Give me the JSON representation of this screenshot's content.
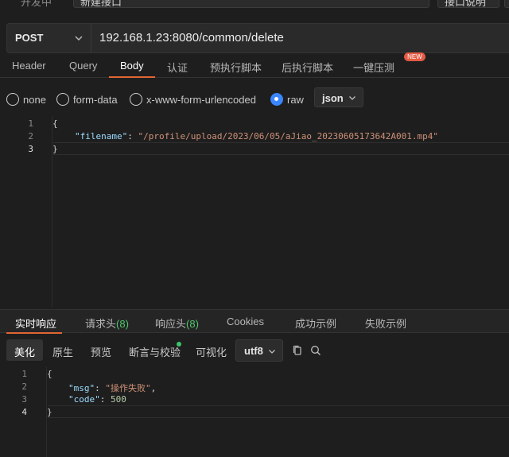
{
  "top": {
    "label": "开发中",
    "name_value": "新建接口",
    "button": "接口说明"
  },
  "request": {
    "method": "POST",
    "url": "192.168.1.23:8080/common/delete"
  },
  "tabs": [
    {
      "label": "Header"
    },
    {
      "label": "Query"
    },
    {
      "label": "Body"
    },
    {
      "label": "认证"
    },
    {
      "label": "预执行脚本"
    },
    {
      "label": "后执行脚本"
    },
    {
      "label": "一键压测"
    }
  ],
  "active_tab": "Body",
  "new_badge": "NEW",
  "body_types": [
    {
      "label": "none",
      "selected": false
    },
    {
      "label": "form-data",
      "selected": false
    },
    {
      "label": "x-www-form-urlencoded",
      "selected": false
    },
    {
      "label": "raw",
      "selected": true
    }
  ],
  "raw_format": "json",
  "request_body": {
    "line_numbers": [
      "1",
      "2",
      "3"
    ],
    "open_brace": "{",
    "key": "\"filename\"",
    "colon": ": ",
    "value": "\"/profile/upload/2023/06/05/aJiao_20230605173642A001.mp4\"",
    "close_brace": "}"
  },
  "response_tabs": [
    {
      "label": "实时响应",
      "count": ""
    },
    {
      "label": "请求头",
      "count": "(8)"
    },
    {
      "label": "响应头",
      "count": "(8)"
    },
    {
      "label": "Cookies",
      "count": ""
    },
    {
      "label": "成功示例",
      "count": ""
    },
    {
      "label": "失败示例",
      "count": ""
    }
  ],
  "view_modes": [
    {
      "label": "美化"
    },
    {
      "label": "原生"
    },
    {
      "label": "预览"
    },
    {
      "label": "断言与校验"
    },
    {
      "label": "可视化"
    }
  ],
  "encoding": "utf8",
  "response_body": {
    "line_numbers": [
      "1",
      "2",
      "3",
      "4"
    ],
    "open_brace": "{",
    "msg_key": "\"msg\"",
    "msg_value": "\"操作失败\"",
    "code_key": "\"code\"",
    "code_value": "500",
    "close_brace": "}"
  },
  "colors": {
    "accent": "#e06633",
    "radio_selected": "#3a86ff",
    "count_green": "#4ec96b",
    "json_key": "#9cdcfe",
    "json_string": "#ce9178",
    "json_number": "#b5cea8",
    "badge": "#e35b44"
  },
  "icons": {
    "method_dropdown": "chevron-down-icon",
    "copy": "copy-icon",
    "search": "search-icon"
  }
}
